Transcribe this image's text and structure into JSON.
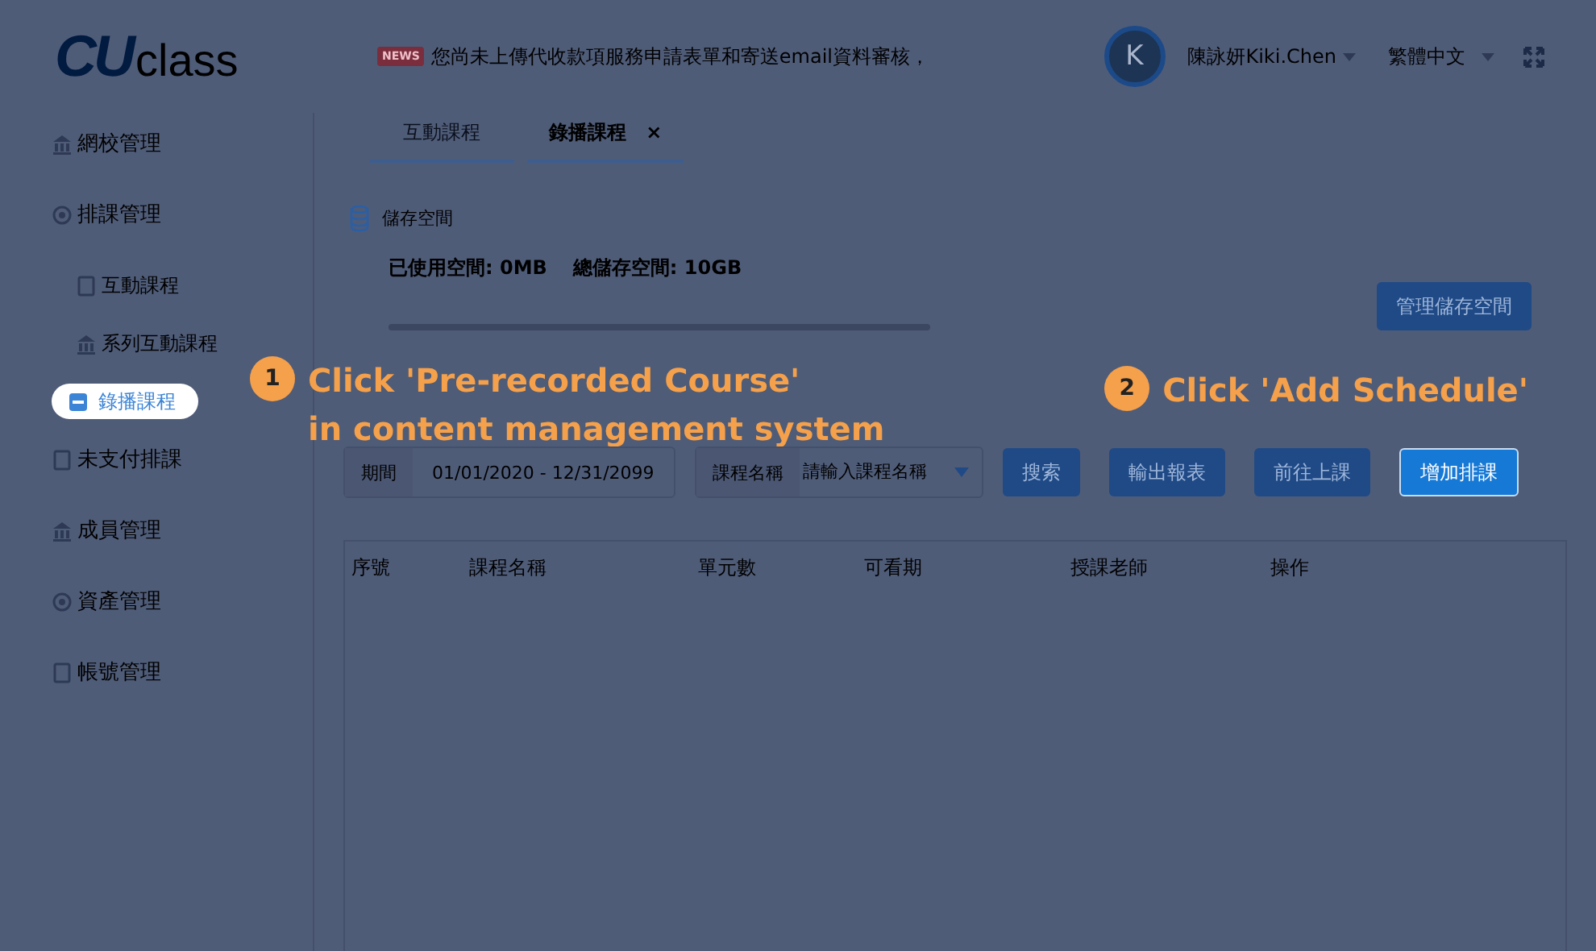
{
  "header": {
    "logo": {
      "mark": "CU",
      "word": "class"
    },
    "notice": {
      "badge": "NEWS",
      "text": "您尚未上傳代收款項服務申請表單和寄送email資料審核，"
    },
    "user": {
      "avatar_letter": "K",
      "name": "陳詠妍Kiki.Chen"
    },
    "language": "繁體中文"
  },
  "sidebar": {
    "items": [
      {
        "label": "網校管理",
        "selected": false
      },
      {
        "label": "排課管理",
        "selected": false,
        "children": [
          {
            "label": "互動課程",
            "selected": false
          },
          {
            "label": "系列互動課程",
            "selected": false
          },
          {
            "label": "錄播課程",
            "selected": true
          }
        ]
      },
      {
        "label": "未支付排課",
        "selected": false
      },
      {
        "label": "成員管理",
        "selected": false
      },
      {
        "label": "資產管理",
        "selected": false
      },
      {
        "label": "帳號管理",
        "selected": false
      }
    ]
  },
  "tabs": [
    {
      "label": "互動課程",
      "selected": false
    },
    {
      "label": "錄播課程",
      "selected": true,
      "close": "×"
    }
  ],
  "storage": {
    "title": "儲存空間",
    "used_label": "已使用空間:",
    "used": "0MB",
    "total_label": "總儲存空間:",
    "total": "10GB",
    "level": 0,
    "button": "管理儲存空間"
  },
  "filters": [
    {
      "label": "期間",
      "value": "01/01/2020 - 12/31/2099"
    },
    {
      "label": "課程名稱",
      "placeholder": "請輸入課程名稱"
    }
  ],
  "buttons": [
    {
      "label": "搜索",
      "highlighted": false
    },
    {
      "label": "輸出報表",
      "highlighted": false
    },
    {
      "label": "前往上課",
      "highlighted": false
    },
    {
      "label": "增加排課",
      "highlighted": true
    }
  ],
  "table": {
    "columns": [
      "序號",
      "課程名稱",
      "單元數",
      "可看期",
      "授課老師",
      "操作"
    ]
  },
  "guide": [
    {
      "number": "1",
      "lines": [
        "Click 'Pre-recorded Course'",
        "in content management system"
      ]
    },
    {
      "number": "2",
      "lines": [
        "Click 'Add Schedule'"
      ]
    }
  ]
}
